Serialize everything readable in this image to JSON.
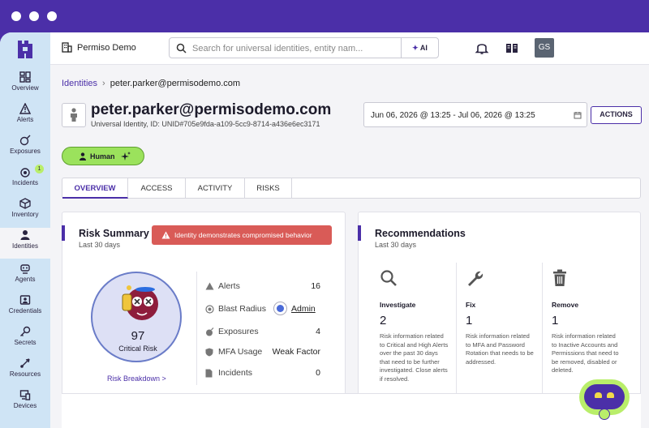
{
  "sidebar": {
    "items": [
      {
        "label": "Overview",
        "icon": "overview-icon"
      },
      {
        "label": "Alerts",
        "icon": "alert-icon"
      },
      {
        "label": "Exposures",
        "icon": "exposure-icon"
      },
      {
        "label": "Incidents",
        "icon": "incident-icon",
        "badge": "1"
      },
      {
        "label": "Inventory",
        "icon": "inventory-icon"
      },
      {
        "label": "Identities",
        "icon": "identity-icon",
        "active": true
      },
      {
        "label": "Agents",
        "icon": "agent-icon"
      },
      {
        "label": "Credentials",
        "icon": "credentials-icon"
      },
      {
        "label": "Secrets",
        "icon": "key-icon"
      },
      {
        "label": "Resources",
        "icon": "resources-icon"
      },
      {
        "label": "Devices",
        "icon": "devices-icon"
      }
    ]
  },
  "topbar": {
    "org_name": "Permiso Demo",
    "search_placeholder": "Search for universal identities, entity nam...",
    "ai_label": "AI",
    "avatar_initials": "GS"
  },
  "breadcrumb": {
    "root": "Identities",
    "current": "peter.parker@permisodemo.com"
  },
  "identity": {
    "title": "peter.parker@permisodemo.com",
    "subtitle": "Universal Identity, ID: UNID#705e9fda-a109-5cc9-8714-a436e6ec3171",
    "type_label": "Human"
  },
  "date_range": "Jun 06, 2026 @ 13:25 - Jul 06, 2026 @ 13:25",
  "actions_label": "ACTIONS",
  "tabs": [
    "OVERVIEW",
    "ACCESS",
    "ACTIVITY",
    "RISKS"
  ],
  "risk_summary": {
    "title": "Risk Summary",
    "subtitle": "Last 30 days",
    "alert": "Identity demonstrates compromised behavior",
    "score": "97",
    "score_label": "Critical Risk",
    "breakdown_link": "Risk Breakdown >",
    "metrics": {
      "alerts": {
        "label": "Alerts",
        "value": "16"
      },
      "blast_radius": {
        "label": "Blast Radius",
        "value": "Admin"
      },
      "exposures": {
        "label": "Exposures",
        "value": "4"
      },
      "mfa": {
        "label": "MFA Usage",
        "value": "Weak Factor"
      },
      "incidents": {
        "label": "Incidents",
        "value": "0"
      }
    }
  },
  "recommendations": {
    "title": "Recommendations",
    "subtitle": "Last 30 days",
    "items": [
      {
        "title": "Investigate",
        "count": "2",
        "desc": "Risk information related to Critical and High Alerts over the past 30 days that need to be further investigated. Close alerts if resolved.",
        "icon": "search-icon"
      },
      {
        "title": "Fix",
        "count": "1",
        "desc": "Risk information related to MFA and Password Rotation that needs to be addressed.",
        "icon": "wrench-icon"
      },
      {
        "title": "Remove",
        "count": "1",
        "desc": "Risk information related to Inactive Accounts and Permissions that need to be removed, disabled or deleted.",
        "icon": "trash-icon"
      }
    ]
  },
  "colors": {
    "brand": "#4b2fa8",
    "accent_green": "#9be25c",
    "alert_red": "#d95b57",
    "sidebar_bg": "#cfe4f5"
  }
}
